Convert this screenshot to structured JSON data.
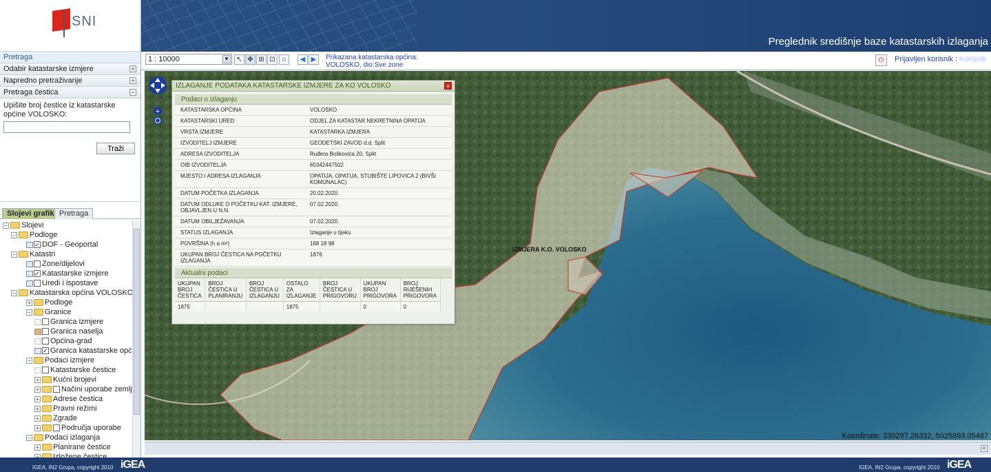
{
  "logo": {
    "text": "SNI"
  },
  "header": {
    "title": "Preglednik središnje baze katastarskih izlaganja"
  },
  "sidebar": {
    "accordion": [
      {
        "label": "Pretraga"
      },
      {
        "label": "Odabir katastarske izmjere"
      },
      {
        "label": "Napredno pretraživanje"
      },
      {
        "label": "Pretraga čestica"
      }
    ],
    "search_label": "Upišite broj čestice iz katastarske općine VOLOSKO:",
    "search_value": "",
    "search_button": "Traži",
    "tabs": [
      {
        "label": "Slojevi grafike"
      },
      {
        "label": "Pretraga"
      }
    ],
    "tree": [
      {
        "label": "Slojevi",
        "level": 0,
        "kind": "folder",
        "exp": "-"
      },
      {
        "label": "Podloge",
        "level": 1,
        "kind": "folder",
        "exp": "-"
      },
      {
        "label": "DOF - Geoportal",
        "level": 2,
        "kind": "layer",
        "checked": true,
        "icon": "blue"
      },
      {
        "label": "Katastri",
        "level": 1,
        "kind": "folder",
        "exp": "-"
      },
      {
        "label": "Zone/dijelovi",
        "level": 2,
        "kind": "layer",
        "checked": false,
        "icon": "blue"
      },
      {
        "label": "Katastarske izmjere",
        "level": 2,
        "kind": "layer",
        "checked": true,
        "icon": "blue"
      },
      {
        "label": "Uredi i ispostave",
        "level": 2,
        "kind": "layer",
        "checked": false,
        "icon": "blue"
      },
      {
        "label": "Katastarska općina VOLOSKO",
        "level": 1,
        "kind": "folder",
        "exp": "-"
      },
      {
        "label": "Podloge",
        "level": 2,
        "kind": "folder",
        "exp": "+"
      },
      {
        "label": "Granice",
        "level": 2,
        "kind": "folder",
        "exp": "-"
      },
      {
        "label": "Granica izmjere",
        "level": 3,
        "kind": "layer",
        "checked": false,
        "icon": "empty"
      },
      {
        "label": "Granica naselja",
        "level": 3,
        "kind": "layer",
        "checked": false,
        "icon": "tan"
      },
      {
        "label": "Općina-grad",
        "level": 3,
        "kind": "layer",
        "checked": false,
        "icon": "empty"
      },
      {
        "label": "Granica katastarske općine",
        "level": 3,
        "kind": "layer",
        "checked": true,
        "icon": "blue"
      },
      {
        "label": "Podaci izmjere",
        "level": 2,
        "kind": "folder",
        "exp": "-"
      },
      {
        "label": "Katastarske čestice",
        "level": 3,
        "kind": "layer",
        "checked": false,
        "icon": "empty"
      },
      {
        "label": "Kućni brojevi",
        "level": 3,
        "kind": "folder",
        "exp": "+"
      },
      {
        "label": "Načini uporabe zemljišta",
        "level": 3,
        "kind": "folder",
        "exp": "+",
        "checkbox": true
      },
      {
        "label": "Adrese čestica",
        "level": 3,
        "kind": "folder",
        "exp": "+"
      },
      {
        "label": "Pravni režimi",
        "level": 3,
        "kind": "folder",
        "exp": "+"
      },
      {
        "label": "Zgrade",
        "level": 3,
        "kind": "folder",
        "exp": "+"
      },
      {
        "label": "Područja uporabe",
        "level": 3,
        "kind": "folder",
        "exp": "+",
        "checkbox": true
      },
      {
        "label": "Podaci izlaganja",
        "level": 2,
        "kind": "folder",
        "exp": "-"
      },
      {
        "label": "Planirane čestice",
        "level": 3,
        "kind": "folder",
        "exp": "+"
      },
      {
        "label": "Izložene čestice",
        "level": 3,
        "kind": "folder",
        "exp": "+"
      }
    ]
  },
  "toolbar": {
    "scale": "1 : 10000",
    "info_line1": "Prikazana katastarska općina:",
    "info_line2": "VOLOSKO, dio:Sve zone",
    "user_label": "Prijavljen korisnik :",
    "user_name": "Korisnik"
  },
  "map": {
    "label": "IZMJERA K.O. VOLOSKO",
    "coords": "Koordinate:  330297.26332, 5025893.05487"
  },
  "popup": {
    "title": "IZLAGANJE PODATAKA KATASTARSKE IZMJERE ZA KO VOLOSKO",
    "section1": "Podaci o izlaganju",
    "rows": [
      {
        "k": "KATASTARSKA OPĆINA",
        "v": "VOLOSKO"
      },
      {
        "k": "KATASTARSKI URED",
        "v": "ODJEL ZA KATASTAR NEKRETNINA OPATIJA"
      },
      {
        "k": "VRSTA IZMJERE",
        "v": "KATASTARKA IZMJERA"
      },
      {
        "k": "IZVODITELJ IZMJERE",
        "v": "GEODETSKI ZAVOD d.d. Split"
      },
      {
        "k": "ADRESA IZVODITELJA",
        "v": "Ruđera Boškovića 20, Split"
      },
      {
        "k": "OIB IZVODITELJA",
        "v": "65342447502"
      },
      {
        "k": "MJESTO I ADRESA IZLAGANJA",
        "v": "OPATIJA, OPATIJA, STUBIŠTE LIPOVICA 2 (BIVŠI KOMUNALAC)"
      },
      {
        "k": "DATUM POČETKA IZLAGANJA",
        "v": "20.02.2020."
      },
      {
        "k": "DATUM ODLUKE O POČETKU KAT. IZMJERE, OBJAVLJEN U N.N.",
        "v": "07.02.2020."
      },
      {
        "k": "DATUM OBILJEŽAVANJA",
        "v": "07.02.2020."
      },
      {
        "k": "STATUS IZLAGANJA",
        "v": "Izlaganje u tijeku"
      },
      {
        "k": "POVRŠINA (h a m²)",
        "v": "168 18 98"
      },
      {
        "k": "UKUPAN BROJ ČESTICA NA POČETKU IZLAGANJA",
        "v": "1876"
      }
    ],
    "section2": "Aktualni podaci",
    "stats_headers": [
      "UKUPAN BROJ ČESTICA",
      "BROJ ČESTICA U PLANIRANJU",
      "BROJ ČESTICA U IZLAGANJU",
      "OSTALO ZA IZLAGANJE",
      "BROJ ČESTICA U PRIGOVORU",
      "UKUPAN BROJ PRIGOVORA",
      "BROJ RIJEŠENIH PRIGOVORA"
    ],
    "stats_values": [
      "1875",
      "",
      "",
      "1875",
      "",
      "0",
      "0"
    ]
  },
  "footer": {
    "copyright_left": "IGEA, IN2 Grupa, copyright 2010",
    "copyright_right": "IGEA, IN2 Grupa, copyright 2010",
    "brand": "iGEA"
  }
}
